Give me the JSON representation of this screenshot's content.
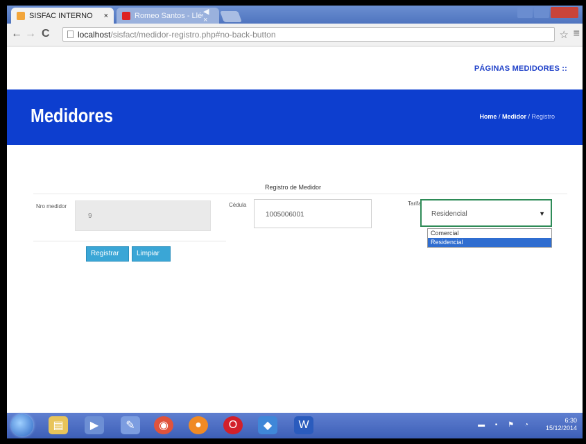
{
  "browser": {
    "tabs": [
      {
        "label": "SISFAC INTERNO",
        "close": "×",
        "active": true
      },
      {
        "label": "Romeo Santos - Llévo...",
        "close": "◀ ×",
        "active": false
      }
    ],
    "url_host": "localhost",
    "url_path": "/sisfact/medidor-registro.php#no-back-button",
    "back": "←",
    "forward": "→",
    "reload": "C",
    "star": "☆",
    "menu": "≡"
  },
  "page": {
    "top_link": "PÁGINAS MEDIDORES ::",
    "banner_title": "Medidores",
    "breadcrumb": {
      "home": "Home",
      "sep1": " / ",
      "medidor": "Medidor",
      "sep2": " / ",
      "current": "Registro"
    },
    "form": {
      "title": "Registro de Medidor",
      "nro_label": "Nro medidor",
      "nro_value": "9",
      "cedula_label": "Cédula",
      "cedula_value": "1005006001",
      "tarifa_label": "Tarifa",
      "tarifa_selected": "Residencial",
      "tarifa_options": [
        "Comercial",
        "Residencial"
      ]
    },
    "buttons": {
      "register": "Registrar",
      "clear": "Limpiar"
    }
  },
  "taskbar": {
    "time": "6:30",
    "date": "15/12/2014",
    "tray_icons": "▬ ▪ ⚑ ◔"
  }
}
